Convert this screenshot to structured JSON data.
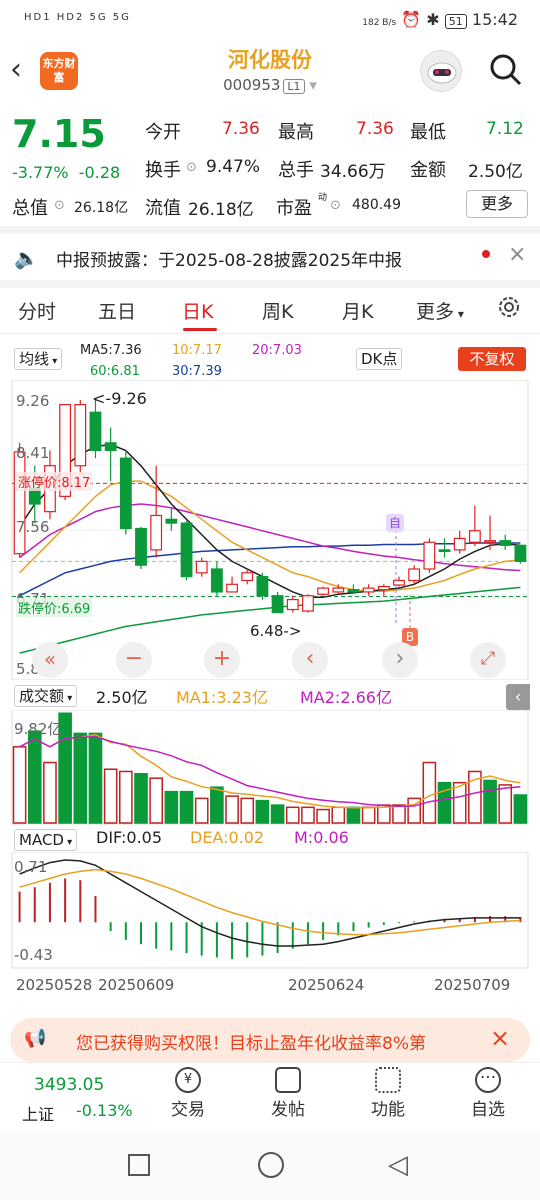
{
  "status_bar": {
    "left": "HD1 HD2 5G 5G",
    "net_speed": "182 B/s",
    "battery": "51",
    "time": "15:42"
  },
  "header": {
    "logo_text": "东方财富",
    "title": "河化股份",
    "code": "000953",
    "level": "L1"
  },
  "quote": {
    "price": "7.15",
    "change_pct": "-3.77%",
    "change": "-0.28",
    "open_label": "今开",
    "open": "7.36",
    "high_label": "最高",
    "high": "7.36",
    "low_label": "最低",
    "low": "7.12",
    "turnover_label": "换手",
    "turnover": "9.47%",
    "volume_label": "总手",
    "volume": "34.66万",
    "amount_label": "金额",
    "amount": "2.50亿",
    "total_cap_label": "总值",
    "total_cap": "26.18亿",
    "float_cap_label": "流值",
    "float_cap": "26.18亿",
    "pe_label": "市盈",
    "pe_sup": "动",
    "pe": "480.49",
    "more": "更多"
  },
  "notice": {
    "text": "中报预披露：于2025-08-28披露2025年中报"
  },
  "tabs": [
    "分时",
    "五日",
    "日K",
    "周K",
    "月K",
    "更多"
  ],
  "active_tab": "日K",
  "kline": {
    "ma_selector": "均线",
    "ma5": "MA5:7.36",
    "ma10": "10:7.17",
    "ma20": "20:7.03",
    "ma60": "60:6.81",
    "ma30": "30:7.39",
    "dk_btn": "DK点",
    "fq_btn": "不复权",
    "y_labels": [
      "9.26",
      "8.41",
      "7.56",
      "6.71",
      "5.86"
    ],
    "limit_up": "涨停价:8.17",
    "limit_down": "跌停价:6.69",
    "high_mark": "9.26",
    "low_mark": "6.48",
    "sell_mark": "自",
    "buy_mark": "B",
    "candles": [
      {
        "o": 7.25,
        "c": 8.58,
        "h": 8.7,
        "l": 7.2
      },
      {
        "o": 8.1,
        "c": 7.9,
        "h": 8.4,
        "l": 7.65
      },
      {
        "o": 7.8,
        "c": 8.4,
        "h": 8.6,
        "l": 7.7
      },
      {
        "o": 8.0,
        "c": 9.2,
        "h": 9.2,
        "l": 7.95
      },
      {
        "o": 8.4,
        "c": 9.2,
        "h": 9.26,
        "l": 8.3
      },
      {
        "o": 9.1,
        "c": 8.6,
        "h": 9.26,
        "l": 8.5
      },
      {
        "o": 8.7,
        "c": 8.6,
        "h": 8.9,
        "l": 8.2
      },
      {
        "o": 8.5,
        "c": 7.58,
        "h": 8.6,
        "l": 7.5
      },
      {
        "o": 7.58,
        "c": 7.1,
        "h": 7.6,
        "l": 7.05
      },
      {
        "o": 7.3,
        "c": 7.75,
        "h": 8.4,
        "l": 7.2
      },
      {
        "o": 7.7,
        "c": 7.65,
        "h": 7.85,
        "l": 7.55
      },
      {
        "o": 7.65,
        "c": 6.95,
        "h": 7.68,
        "l": 6.9
      },
      {
        "o": 7.0,
        "c": 7.15,
        "h": 7.2,
        "l": 6.95
      },
      {
        "o": 7.05,
        "c": 6.75,
        "h": 7.15,
        "l": 6.7
      },
      {
        "o": 6.75,
        "c": 6.85,
        "h": 6.95,
        "l": 6.75
      },
      {
        "o": 6.9,
        "c": 7.0,
        "h": 7.05,
        "l": 6.85
      },
      {
        "o": 6.95,
        "c": 6.7,
        "h": 7.0,
        "l": 6.65
      },
      {
        "o": 6.7,
        "c": 6.48,
        "h": 6.75,
        "l": 6.48
      },
      {
        "o": 6.52,
        "c": 6.65,
        "h": 6.7,
        "l": 6.48
      },
      {
        "o": 6.5,
        "c": 6.7,
        "h": 6.72,
        "l": 6.48
      },
      {
        "o": 6.72,
        "c": 6.8,
        "h": 6.82,
        "l": 6.7
      },
      {
        "o": 6.75,
        "c": 6.8,
        "h": 6.85,
        "l": 6.72
      },
      {
        "o": 6.78,
        "c": 6.75,
        "h": 6.85,
        "l": 6.72
      },
      {
        "o": 6.75,
        "c": 6.8,
        "h": 6.85,
        "l": 6.7
      },
      {
        "o": 6.78,
        "c": 6.82,
        "h": 6.85,
        "l": 6.7
      },
      {
        "o": 6.84,
        "c": 6.9,
        "h": 6.95,
        "l": 6.82
      },
      {
        "o": 6.9,
        "c": 7.05,
        "h": 7.1,
        "l": 6.85
      },
      {
        "o": 7.05,
        "c": 7.4,
        "h": 7.45,
        "l": 7.0
      },
      {
        "o": 7.3,
        "c": 7.28,
        "h": 7.45,
        "l": 7.2
      },
      {
        "o": 7.3,
        "c": 7.45,
        "h": 7.55,
        "l": 7.25
      },
      {
        "o": 7.4,
        "c": 7.55,
        "h": 7.88,
        "l": 7.35
      },
      {
        "o": 7.42,
        "c": 7.42,
        "h": 7.75,
        "l": 7.3
      },
      {
        "o": 7.42,
        "c": 7.36,
        "h": 7.5,
        "l": 7.3
      },
      {
        "o": 7.36,
        "c": 7.15,
        "h": 7.36,
        "l": 7.12
      }
    ],
    "ma5_line": [
      7.6,
      7.9,
      8.1,
      8.4,
      8.55,
      8.65,
      8.68,
      8.6,
      8.4,
      8.15,
      7.9,
      7.7,
      7.5,
      7.3,
      7.15,
      7.05,
      6.95,
      6.85,
      6.75,
      6.68,
      6.68,
      6.72,
      6.74,
      6.76,
      6.78,
      6.8,
      6.85,
      6.95,
      7.05,
      7.18,
      7.28,
      7.36,
      7.38,
      7.36
    ],
    "ma10_line": [
      7.0,
      7.2,
      7.4,
      7.6,
      7.8,
      8.0,
      8.15,
      8.2,
      8.2,
      8.1,
      8.0,
      7.85,
      7.7,
      7.55,
      7.4,
      7.3,
      7.2,
      7.1,
      7.0,
      6.95,
      6.88,
      6.82,
      6.78,
      6.76,
      6.76,
      6.78,
      6.8,
      6.85,
      6.9,
      6.98,
      7.05,
      7.1,
      7.15,
      7.17
    ],
    "ma20_line": [
      7.2,
      7.35,
      7.5,
      7.6,
      7.7,
      7.8,
      7.85,
      7.88,
      7.9,
      7.88,
      7.85,
      7.8,
      7.75,
      7.7,
      7.65,
      7.6,
      7.55,
      7.5,
      7.45,
      7.4,
      7.35,
      7.32,
      7.28,
      7.25,
      7.22,
      7.2,
      7.17,
      7.15,
      7.12,
      7.1,
      7.08,
      7.06,
      7.04,
      7.03
    ],
    "ma30_line": [
      6.7,
      6.8,
      6.9,
      7.0,
      7.05,
      7.1,
      7.15,
      7.18,
      7.2,
      7.22,
      7.24,
      7.26,
      7.28,
      7.29,
      7.3,
      7.31,
      7.32,
      7.33,
      7.34,
      7.34,
      7.35,
      7.35,
      7.36,
      7.36,
      7.37,
      7.37,
      7.37,
      7.38,
      7.38,
      7.38,
      7.39,
      7.39,
      7.39,
      7.39
    ],
    "ma60_line": [
      5.95,
      6.0,
      6.05,
      6.1,
      6.15,
      6.2,
      6.25,
      6.3,
      6.33,
      6.36,
      6.39,
      6.42,
      6.45,
      6.47,
      6.49,
      6.51,
      6.53,
      6.55,
      6.57,
      6.58,
      6.59,
      6.6,
      6.61,
      6.62,
      6.63,
      6.65,
      6.67,
      6.69,
      6.71,
      6.73,
      6.75,
      6.77,
      6.79,
      6.81
    ],
    "ymin": 5.86,
    "ymax": 9.26
  },
  "volume": {
    "label": "成交额",
    "value": "2.50亿",
    "ma1": "MA1:3.23亿",
    "ma2": "MA2:2.66亿",
    "top_label": "9.82亿",
    "bars": [
      6.8,
      8.2,
      5.4,
      9.8,
      8.0,
      8.0,
      4.8,
      4.6,
      4.4,
      4.0,
      2.8,
      2.8,
      2.2,
      3.2,
      2.4,
      2.2,
      2.0,
      1.6,
      1.4,
      1.4,
      1.2,
      1.4,
      1.4,
      1.4,
      1.6,
      1.6,
      2.2,
      5.4,
      3.6,
      3.6,
      4.6,
      3.8,
      3.4,
      2.5
    ],
    "up": [
      true,
      false,
      true,
      false,
      false,
      false,
      true,
      true,
      false,
      true,
      false,
      false,
      true,
      false,
      true,
      true,
      false,
      false,
      true,
      true,
      true,
      true,
      false,
      true,
      true,
      true,
      true,
      true,
      false,
      true,
      true,
      false,
      true,
      false
    ],
    "ymax": 10
  },
  "macd": {
    "label": "MACD",
    "dif": "DIF:0.05",
    "dea": "DEA:0.02",
    "m": "M:0.06",
    "top_label": "0.71",
    "bottom_label": "-0.43",
    "hist": [
      0.35,
      0.4,
      0.45,
      0.5,
      0.48,
      0.3,
      -0.1,
      -0.2,
      -0.25,
      -0.3,
      -0.32,
      -0.35,
      -0.38,
      -0.4,
      -0.42,
      -0.4,
      -0.38,
      -0.35,
      -0.3,
      -0.25,
      -0.2,
      -0.15,
      -0.1,
      -0.06,
      -0.03,
      -0.01,
      0.01,
      0.02,
      0.04,
      0.05,
      0.06,
      0.07,
      0.07,
      0.06
    ],
    "dif_line": [
      0.55,
      0.62,
      0.68,
      0.71,
      0.7,
      0.65,
      0.55,
      0.45,
      0.35,
      0.25,
      0.15,
      0.05,
      -0.05,
      -0.12,
      -0.18,
      -0.22,
      -0.25,
      -0.27,
      -0.27,
      -0.26,
      -0.25,
      -0.22,
      -0.18,
      -0.14,
      -0.1,
      -0.06,
      -0.02,
      0.01,
      0.03,
      0.04,
      0.05,
      0.05,
      0.05,
      0.05
    ],
    "dea_line": [
      0.4,
      0.45,
      0.5,
      0.55,
      0.58,
      0.6,
      0.58,
      0.55,
      0.5,
      0.44,
      0.38,
      0.31,
      0.24,
      0.17,
      0.11,
      0.06,
      0.01,
      -0.03,
      -0.07,
      -0.1,
      -0.12,
      -0.13,
      -0.14,
      -0.14,
      -0.13,
      -0.12,
      -0.1,
      -0.08,
      -0.06,
      -0.04,
      -0.02,
      0.0,
      0.01,
      0.02
    ],
    "ymin": -0.43,
    "ymax": 0.71
  },
  "dates": [
    "20250528",
    "20250609",
    "20250624",
    "20250709"
  ],
  "ad": {
    "text": "您已获得购买权限！目标止盈年化收益率8%第"
  },
  "bottom_nav": {
    "index_value": "3493.05",
    "index_name": "上证",
    "index_change": "-0.13%",
    "items": [
      "交易",
      "发帖",
      "功能",
      "自选"
    ]
  }
}
